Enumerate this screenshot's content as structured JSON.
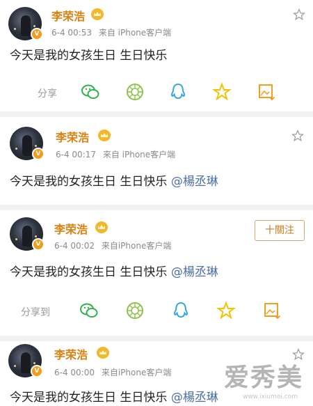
{
  "posts": [
    {
      "author": "李荣浩",
      "time": "6-4 00:53",
      "source": "来自 iPhone客户端",
      "text": "今天是我的女孩生日 生日快乐",
      "mention": "",
      "share_label": "分享"
    },
    {
      "author": "李荣浩",
      "time": "6-4 00:17",
      "source": "来自 iPhone客户端",
      "text": "今天是我的女孩生日 生日快乐 ",
      "mention": "@楊丞琳"
    },
    {
      "author": "李荣浩",
      "time": "6-4 00:02",
      "source": "来自iPhone客户端",
      "text": "今天是我的女孩生日 生日快乐 ",
      "mention": "@楊丞琳",
      "follow_label": "十關注",
      "share_label": "分享到"
    },
    {
      "author": "李荣浩",
      "time": "6-4 00:00",
      "source": "来自iPhone客户端",
      "text": "今天是我的女孩生日 生日快乐 ",
      "mention": "@楊丞琳"
    }
  ],
  "verified_badge": "V",
  "watermark": "爱秀美",
  "watermark_sub": "www.ixiumei.com",
  "share_icons": [
    "wechat-icon",
    "moments-icon",
    "qq-icon",
    "qzone-star-icon",
    "save-image-icon"
  ],
  "colors": {
    "author_name": "#e0800e",
    "mention": "#4a6fa5",
    "wechat": "#2db34a",
    "moments": "#8bc34a",
    "qq": "#35a7e0",
    "qzone": "#f3c200",
    "save": "#f0a020"
  }
}
